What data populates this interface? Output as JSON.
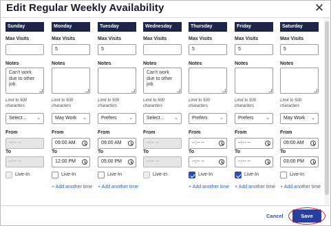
{
  "dialog": {
    "title": "Edit Regular Weekly Availability",
    "close_glyph": "✕"
  },
  "labels": {
    "max_visits": "Max Visits",
    "notes": "Notes",
    "limit": "Limit to 500 characters",
    "from": "From",
    "to": "To",
    "live_in": "Live-In",
    "add_time": "+ Add another time"
  },
  "days": [
    {
      "name": "Sunday",
      "max_visits": "",
      "notes": "Can't work due to other job.",
      "select": "Select...",
      "from": "--:-- --",
      "to": "--:-- --",
      "time_disabled": true,
      "live_in_checked": false,
      "live_in_disabled": true,
      "show_add": false
    },
    {
      "name": "Monday",
      "max_visits": "5",
      "notes": "",
      "select": "May Work",
      "from": "09:00 AM",
      "to": "12:00 PM",
      "time_disabled": false,
      "live_in_checked": false,
      "live_in_disabled": false,
      "show_add": true
    },
    {
      "name": "Tuesday",
      "max_visits": "5",
      "notes": "",
      "select": "Prefers",
      "from": "09:00 AM",
      "to": "05:00 PM",
      "time_disabled": false,
      "live_in_checked": false,
      "live_in_disabled": false,
      "show_add": true
    },
    {
      "name": "Wednesday",
      "max_visits": "",
      "notes": "Can't work due to other job.",
      "select": "Select...",
      "from": "--:-- --",
      "to": "--:-- --",
      "time_disabled": true,
      "live_in_checked": false,
      "live_in_disabled": true,
      "show_add": false
    },
    {
      "name": "Thursday",
      "max_visits": "5",
      "notes": "",
      "select": "Prefers",
      "from": "--:-- --",
      "to": "--:-- --",
      "time_disabled": false,
      "live_in_checked": true,
      "live_in_disabled": false,
      "show_add": true
    },
    {
      "name": "Friday",
      "max_visits": "5",
      "notes": "",
      "select": "Prefers",
      "from": "--:-- --",
      "to": "--:-- --",
      "time_disabled": false,
      "live_in_checked": true,
      "live_in_disabled": false,
      "show_add": true
    },
    {
      "name": "Saturday",
      "max_visits": "5",
      "notes": "",
      "select": "May Work",
      "from": "09:00 AM",
      "to": "03:00 PM",
      "time_disabled": false,
      "live_in_checked": false,
      "live_in_disabled": false,
      "show_add": true
    }
  ],
  "footer": {
    "cancel_label": "Cancel",
    "save_label": "Save"
  },
  "colors": {
    "header_navy": "#1d2646",
    "primary_button": "#2a3e9c",
    "link_blue": "#2e5fb5",
    "annotation_red": "#d62020"
  }
}
